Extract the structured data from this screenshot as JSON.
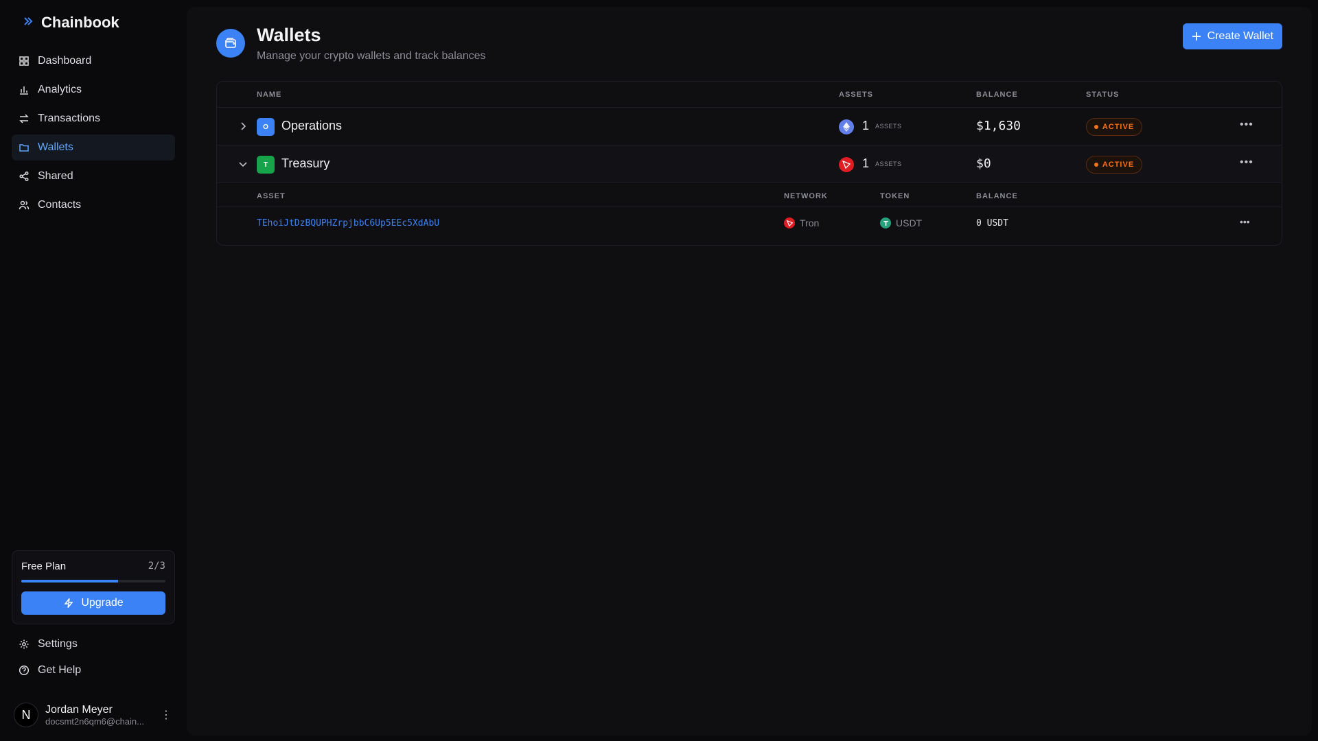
{
  "brand": {
    "name": "Chainbook",
    "icon": "chevrons-right-icon"
  },
  "nav": {
    "items": [
      {
        "label": "Dashboard",
        "icon": "dashboard-icon"
      },
      {
        "label": "Analytics",
        "icon": "bar-chart-icon"
      },
      {
        "label": "Transactions",
        "icon": "arrows-left-right-icon"
      },
      {
        "label": "Wallets",
        "icon": "folder-icon",
        "active": true
      },
      {
        "label": "Shared",
        "icon": "share-icon"
      },
      {
        "label": "Contacts",
        "icon": "users-icon"
      }
    ]
  },
  "plan": {
    "name": "Free Plan",
    "count": "2/3",
    "progress_fraction": 0.67,
    "upgrade_label": "Upgrade"
  },
  "bottom_nav": {
    "settings": "Settings",
    "help": "Get Help"
  },
  "user": {
    "initial": "N",
    "name": "Jordan Meyer",
    "email": "docsmt2n6qm6@chain..."
  },
  "header": {
    "title": "Wallets",
    "subtitle": "Manage your crypto wallets and track balances",
    "create_label": "Create Wallet"
  },
  "table": {
    "columns": {
      "name": "NAME",
      "assets": "ASSETS",
      "balance": "BALANCE",
      "status": "STATUS"
    },
    "rows": [
      {
        "initial": "O",
        "name": "Operations",
        "asset_count": "1",
        "asset_label": "ASSETS",
        "asset_icon": "ethereum-icon",
        "balance": "$1,630",
        "status": "ACTIVE",
        "expanded": false,
        "badge_color": "#3b82f6"
      },
      {
        "initial": "T",
        "name": "Treasury",
        "asset_count": "1",
        "asset_label": "ASSETS",
        "asset_icon": "tron-icon",
        "balance": "$0",
        "status": "ACTIVE",
        "expanded": true,
        "badge_color": "#16a34a"
      }
    ],
    "sub_columns": {
      "asset": "ASSET",
      "network": "NETWORK",
      "token": "TOKEN",
      "balance": "BALANCE"
    },
    "sub_rows": [
      {
        "address": "TEhoiJtDzBQUPHZrpjbbC6Up5EEc5XdAbU",
        "network": "Tron",
        "token": "USDT",
        "balance": "0 USDT"
      }
    ]
  },
  "colors": {
    "accent": "#3b82f6",
    "status": "#f97316",
    "tron": "#e11d24",
    "tether": "#26a17b",
    "ethereum": "#627eea"
  }
}
